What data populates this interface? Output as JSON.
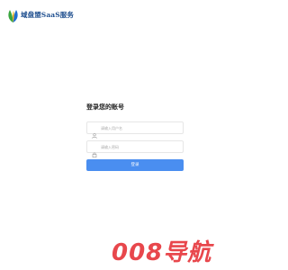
{
  "header": {
    "brand_name": "域盘盟SaaS服务",
    "logo_icon": "leaf-logo-icon"
  },
  "login": {
    "title": "登录您的账号",
    "username": {
      "placeholder": "请输入用户名",
      "icon": "user-icon"
    },
    "password": {
      "placeholder": "请输入密码",
      "icon": "lock-icon"
    },
    "submit_label": "登录"
  },
  "watermark": {
    "text": "008导航",
    "color": "#e8474c"
  },
  "colors": {
    "accent": "#4a8ef0",
    "brand_text": "#1f4f8f"
  }
}
